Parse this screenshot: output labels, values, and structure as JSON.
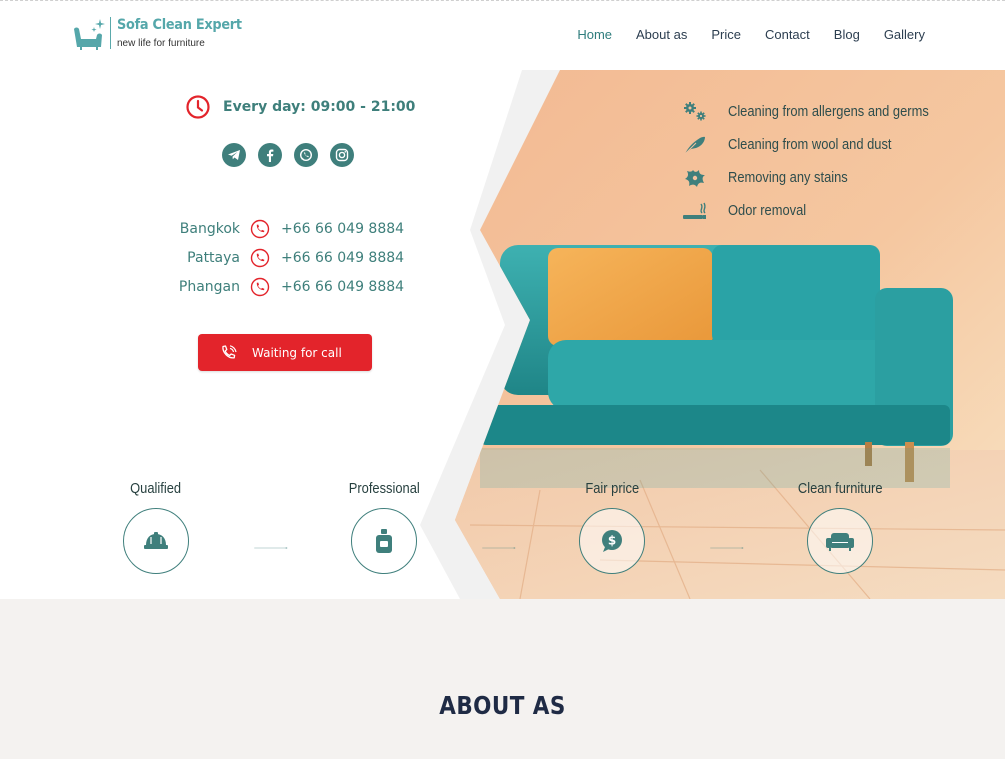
{
  "brand": {
    "title": "Sofa Clean Expert",
    "tagline": "new life for furniture",
    "accent": "#55a7aa"
  },
  "nav": {
    "items": [
      {
        "label": "Home",
        "active": true
      },
      {
        "label": "About as",
        "active": false
      },
      {
        "label": "Price",
        "active": false
      },
      {
        "label": "Contact",
        "active": false
      },
      {
        "label": "Blog",
        "active": false
      },
      {
        "label": "Gallery",
        "active": false
      }
    ]
  },
  "hero": {
    "hours": "Every day: 09:00 - 21:00",
    "socials": [
      "telegram-icon",
      "facebook-icon",
      "whatsapp-icon",
      "instagram-icon"
    ],
    "phones": [
      {
        "city": "Bangkok",
        "number": "+66 66 049 8884"
      },
      {
        "city": "Pattaya",
        "number": "+66 66 049 8884"
      },
      {
        "city": "Phangan",
        "number": "+66 66 049 8884"
      }
    ],
    "call_button": "Waiting for call",
    "features": [
      {
        "icon": "gears-icon",
        "label": "Cleaning from allergens and germs"
      },
      {
        "icon": "feather-icon",
        "label": "Cleaning from wool and dust"
      },
      {
        "icon": "splash-icon",
        "label": "Removing any stains"
      },
      {
        "icon": "incense-icon",
        "label": "Odor removal"
      }
    ],
    "steps": [
      {
        "label": "Qualified",
        "icon": "hard-hat-icon"
      },
      {
        "label": "Professional",
        "icon": "bottle-icon"
      },
      {
        "label": "Fair price",
        "icon": "money-bubble-icon"
      },
      {
        "label": "Clean furniture",
        "icon": "armchair-icon"
      }
    ]
  },
  "about": {
    "title": "ABOUT AS"
  },
  "colors": {
    "primary": "#3f7f7c",
    "cta": "#e3242b",
    "heading": "#1f2b45",
    "section_bg": "#f4f2f0"
  }
}
